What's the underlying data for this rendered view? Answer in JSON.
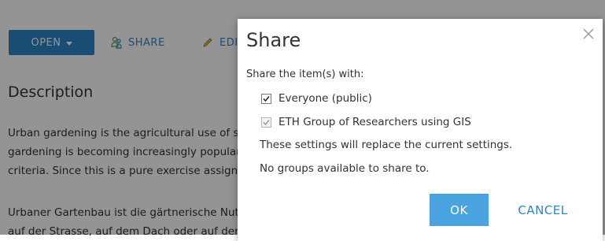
{
  "toolbar": {
    "open_label": "OPEN",
    "share_label": "SHARE",
    "edit_label": "EDIT"
  },
  "description": {
    "heading": "Description",
    "paragraph_en": [
      "Urban gardening is the agricultural use of small areas in towns. Urban",
      "gardening is becoming increasingly popular. The suitability of areas is rated by",
      "criteria. Since this is a pure exercise assignment, the results are not binding."
    ],
    "paragraph_de": [
      "Urbaner Gartenbau ist die gärtnerische Nutzung städtischer Flächen, ob",
      "auf der Strasse, auf dem Dach oder auf dem Balkon."
    ]
  },
  "dialog": {
    "title": "Share",
    "close_symbol": "×",
    "share_with_label": "Share the item(s) with:",
    "options": [
      {
        "label": "Everyone (public)",
        "checked": true,
        "disabled": false
      },
      {
        "label": "ETH Group of Researchers using GIS",
        "checked": true,
        "disabled": true
      }
    ],
    "note_replace": "These settings will replace the current settings.",
    "note_no_groups": "No groups available to share to.",
    "ok_label": "OK",
    "cancel_label": "CANCEL"
  },
  "colors": {
    "accent": "#2b86c8",
    "ok_button": "#4aa3df",
    "overlay": "rgba(0,0,0,0.42)"
  },
  "icons": {
    "share": "share-people-icon",
    "edit": "pencil-icon",
    "close": "close-icon",
    "checkbox": "checkmark-icon"
  }
}
